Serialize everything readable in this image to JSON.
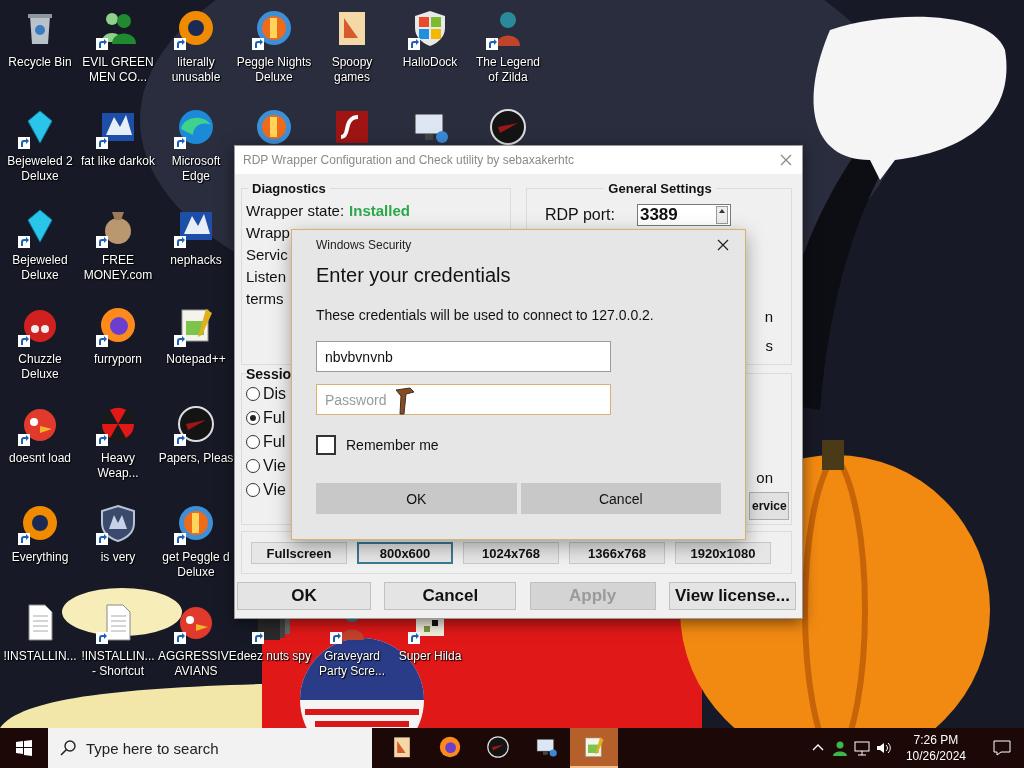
{
  "desktop": {
    "icon_rows": [
      [
        {
          "label": "Recycle Bin",
          "kind": "bin",
          "shortcut": false
        },
        {
          "label": "EVIL GREEN MEN CO...",
          "kind": "people",
          "shortcut": true
        },
        {
          "label": "literally unusable",
          "kind": "ring",
          "shortcut": true
        },
        {
          "label": "Peggle Nights Deluxe",
          "kind": "orb",
          "shortcut": true
        },
        {
          "label": "Spoopy games",
          "kind": "folder",
          "shortcut": false
        },
        {
          "label": "HalloDock",
          "kind": "grid",
          "shortcut": true
        },
        {
          "label": "The Legend of Zilda",
          "kind": "figure",
          "shortcut": true
        }
      ],
      [
        {
          "label": "Bejeweled 2 Deluxe",
          "kind": "gem",
          "shortcut": true
        },
        {
          "label": "fat like darkok",
          "kind": "emblem",
          "shortcut": true
        },
        {
          "label": "Microsoft Edge",
          "kind": "swirl",
          "shortcut": true
        },
        {
          "kind": "orb",
          "shortcut": false
        },
        {
          "kind": "tile",
          "shortcut": false
        },
        {
          "kind": "monitor",
          "shortcut": false
        },
        {
          "kind": "disc",
          "shortcut": false
        }
      ],
      [
        {
          "label": "Bejeweled Deluxe",
          "kind": "gem",
          "shortcut": true
        },
        {
          "label": "FREE MONEY.com",
          "kind": "bag",
          "shortcut": true
        },
        {
          "label": "nephacks",
          "kind": "emblem",
          "shortcut": true
        }
      ],
      [
        {
          "label": "Chuzzle Deluxe",
          "kind": "fuzzball",
          "shortcut": true
        },
        {
          "label": "furryporn",
          "kind": "globe",
          "shortcut": true
        },
        {
          "label": "Notepad++",
          "kind": "notepad",
          "shortcut": true
        }
      ],
      [
        {
          "label": "doesnt load",
          "kind": "bird",
          "shortcut": true
        },
        {
          "label": "Heavy Weap...",
          "kind": "hazard",
          "shortcut": true
        },
        {
          "label": "Papers, Pleas",
          "kind": "disc",
          "shortcut": true
        }
      ],
      [
        {
          "label": "Everything",
          "kind": "ring",
          "shortcut": true
        },
        {
          "label": "is very",
          "kind": "shield",
          "shortcut": true
        },
        {
          "label": "get Peggle d Deluxe",
          "kind": "orb",
          "shortcut": true
        }
      ],
      [
        {
          "label": "!INSTALLIN...",
          "kind": "document",
          "shortcut": false
        },
        {
          "label": "!INSTALLIN... - Shortcut",
          "kind": "document",
          "shortcut": true
        },
        {
          "label": "AGGRESSIVE AVIANS",
          "kind": "bird",
          "shortcut": true
        },
        {
          "label": "deez nuts spy",
          "kind": "stack",
          "shortcut": true
        },
        {
          "label": "Graveyard Party Scre...",
          "kind": "figure",
          "shortcut": true
        },
        {
          "label": "Super Hilda",
          "kind": "pixel",
          "shortcut": true
        }
      ]
    ]
  },
  "rdp_window": {
    "title": "RDP Wrapper Configuration and Check utility by sebaxakerhtc",
    "diagnostics": {
      "heading": "Diagnostics",
      "state_label": "Wrapper state:",
      "state_value": "Installed",
      "lines": [
        "Wrapp",
        "Servic",
        "Listen",
        "terms"
      ]
    },
    "general_settings": {
      "heading": "General Settings",
      "port_label": "RDP port:",
      "port_value": "3389",
      "lines": [
        "n",
        "s"
      ]
    },
    "session": {
      "heading": "Sessio",
      "options": [
        {
          "label": "Dis",
          "selected": false
        },
        {
          "label": "Ful",
          "selected": true
        },
        {
          "label": "Ful",
          "selected": false
        },
        {
          "label": "Vie",
          "selected": false
        },
        {
          "label": "Vie",
          "selected": false
        }
      ]
    },
    "right_panel": {
      "text": "on",
      "button": "ervice"
    },
    "resolutions": [
      {
        "label": "Fullscreen",
        "selected": false
      },
      {
        "label": "800x600",
        "selected": true
      },
      {
        "label": "1024x768",
        "selected": false
      },
      {
        "label": "1366x768",
        "selected": false
      },
      {
        "label": "1920x1080",
        "selected": false
      }
    ],
    "buttons": [
      {
        "label": "OK",
        "disabled": false
      },
      {
        "label": "Cancel",
        "disabled": false
      },
      {
        "label": "Apply",
        "disabled": true
      },
      {
        "label": "View license...",
        "disabled": false
      }
    ]
  },
  "security_dialog": {
    "title": "Windows Security",
    "heading": "Enter your credentials",
    "message": "These credentials will be used to connect to 127.0.0.2.",
    "username": "nbvbvnvnb",
    "password_placeholder": "Password",
    "remember": {
      "label": "Remember me",
      "checked": false
    },
    "buttons": [
      "OK",
      "Cancel"
    ]
  },
  "taskbar": {
    "search_placeholder": "Type here to search",
    "apps": [
      {
        "kind": "folder",
        "selected": false
      },
      {
        "kind": "globe",
        "selected": false
      },
      {
        "kind": "disc",
        "selected": false
      },
      {
        "kind": "monitor",
        "selected": false
      },
      {
        "kind": "notepad",
        "selected": true
      }
    ],
    "time": "7:26 PM",
    "date": "10/26/2024"
  }
}
